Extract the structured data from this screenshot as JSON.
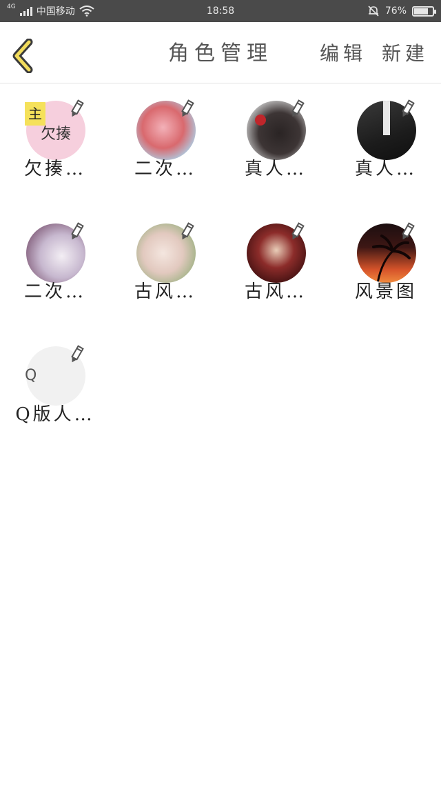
{
  "status_bar": {
    "network": "4G",
    "carrier": "中国移动",
    "time": "18:58",
    "battery": "76%",
    "battery_level": 0.76
  },
  "nav": {
    "title": "角色管理",
    "edit_label": "编辑",
    "new_label": "新建"
  },
  "characters": [
    {
      "name": "欠揍…",
      "badge": "主",
      "avatar_text": "欠揍"
    },
    {
      "name": "二次…"
    },
    {
      "name": "真人…"
    },
    {
      "name": "真人…"
    },
    {
      "name": "二次…"
    },
    {
      "name": "古风…"
    },
    {
      "name": "古风…"
    },
    {
      "name": "风景图"
    },
    {
      "name": "Q版人…",
      "avatar_text": "Q"
    }
  ]
}
